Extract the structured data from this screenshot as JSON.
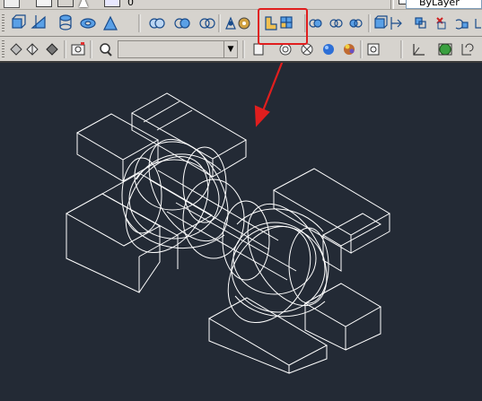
{
  "layer": {
    "name": "ByLayer"
  },
  "toolbar": {
    "current_layer_num": "0"
  },
  "colors": {
    "viewport_bg": "#232a35",
    "highlight": "#e01e1e",
    "wire": "#ffffff",
    "toolbar_bg": "#d6d3ce"
  },
  "icons": [
    "pan-icon",
    "select-icon",
    "box-icon",
    "wedge-icon",
    "cylinder-icon",
    "cone-icon",
    "sphere-icon",
    "torus-icon",
    "orbit-icon",
    "region-icon",
    "union-icon",
    "subtract-icon",
    "intersect-icon",
    "3d-move-icon",
    "3d-rotate-icon",
    "3d-array-icon",
    "shade-icon",
    "render-icon",
    "ucs-icon"
  ]
}
